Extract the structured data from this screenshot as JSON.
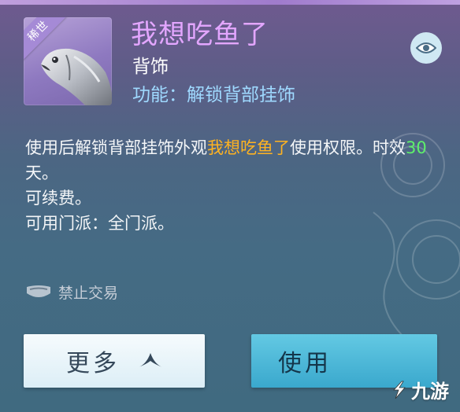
{
  "item": {
    "rarity_tag": "稀世",
    "icon": "fish-icon",
    "title": "我想吃鱼了",
    "type": "背饰",
    "function_label": "功能：",
    "function_value": "解锁背部挂饰"
  },
  "description": {
    "part1": "使用后解锁背部挂饰外观",
    "highlight_name": "我想吃鱼了",
    "part2": "使用权限。时效",
    "days": "30",
    "part3": "天。",
    "line_renew": "可续费。",
    "line_sect": "可用门派：全门派。"
  },
  "trade": {
    "icon": "no-trade-icon",
    "label": "禁止交易"
  },
  "buttons": {
    "more_label": "更多",
    "more_icon": "expand-up-icon",
    "use_label": "使用"
  },
  "watermark": {
    "icon": "jiuyou-logo",
    "text": "九游"
  },
  "colors": {
    "title": "#e3a6ff",
    "function": "#9fd9ff",
    "highlight_name": "#ffb321",
    "highlight_days": "#5ef06b",
    "use_button": "#4ab8d8",
    "more_button": "#eef7fb"
  }
}
